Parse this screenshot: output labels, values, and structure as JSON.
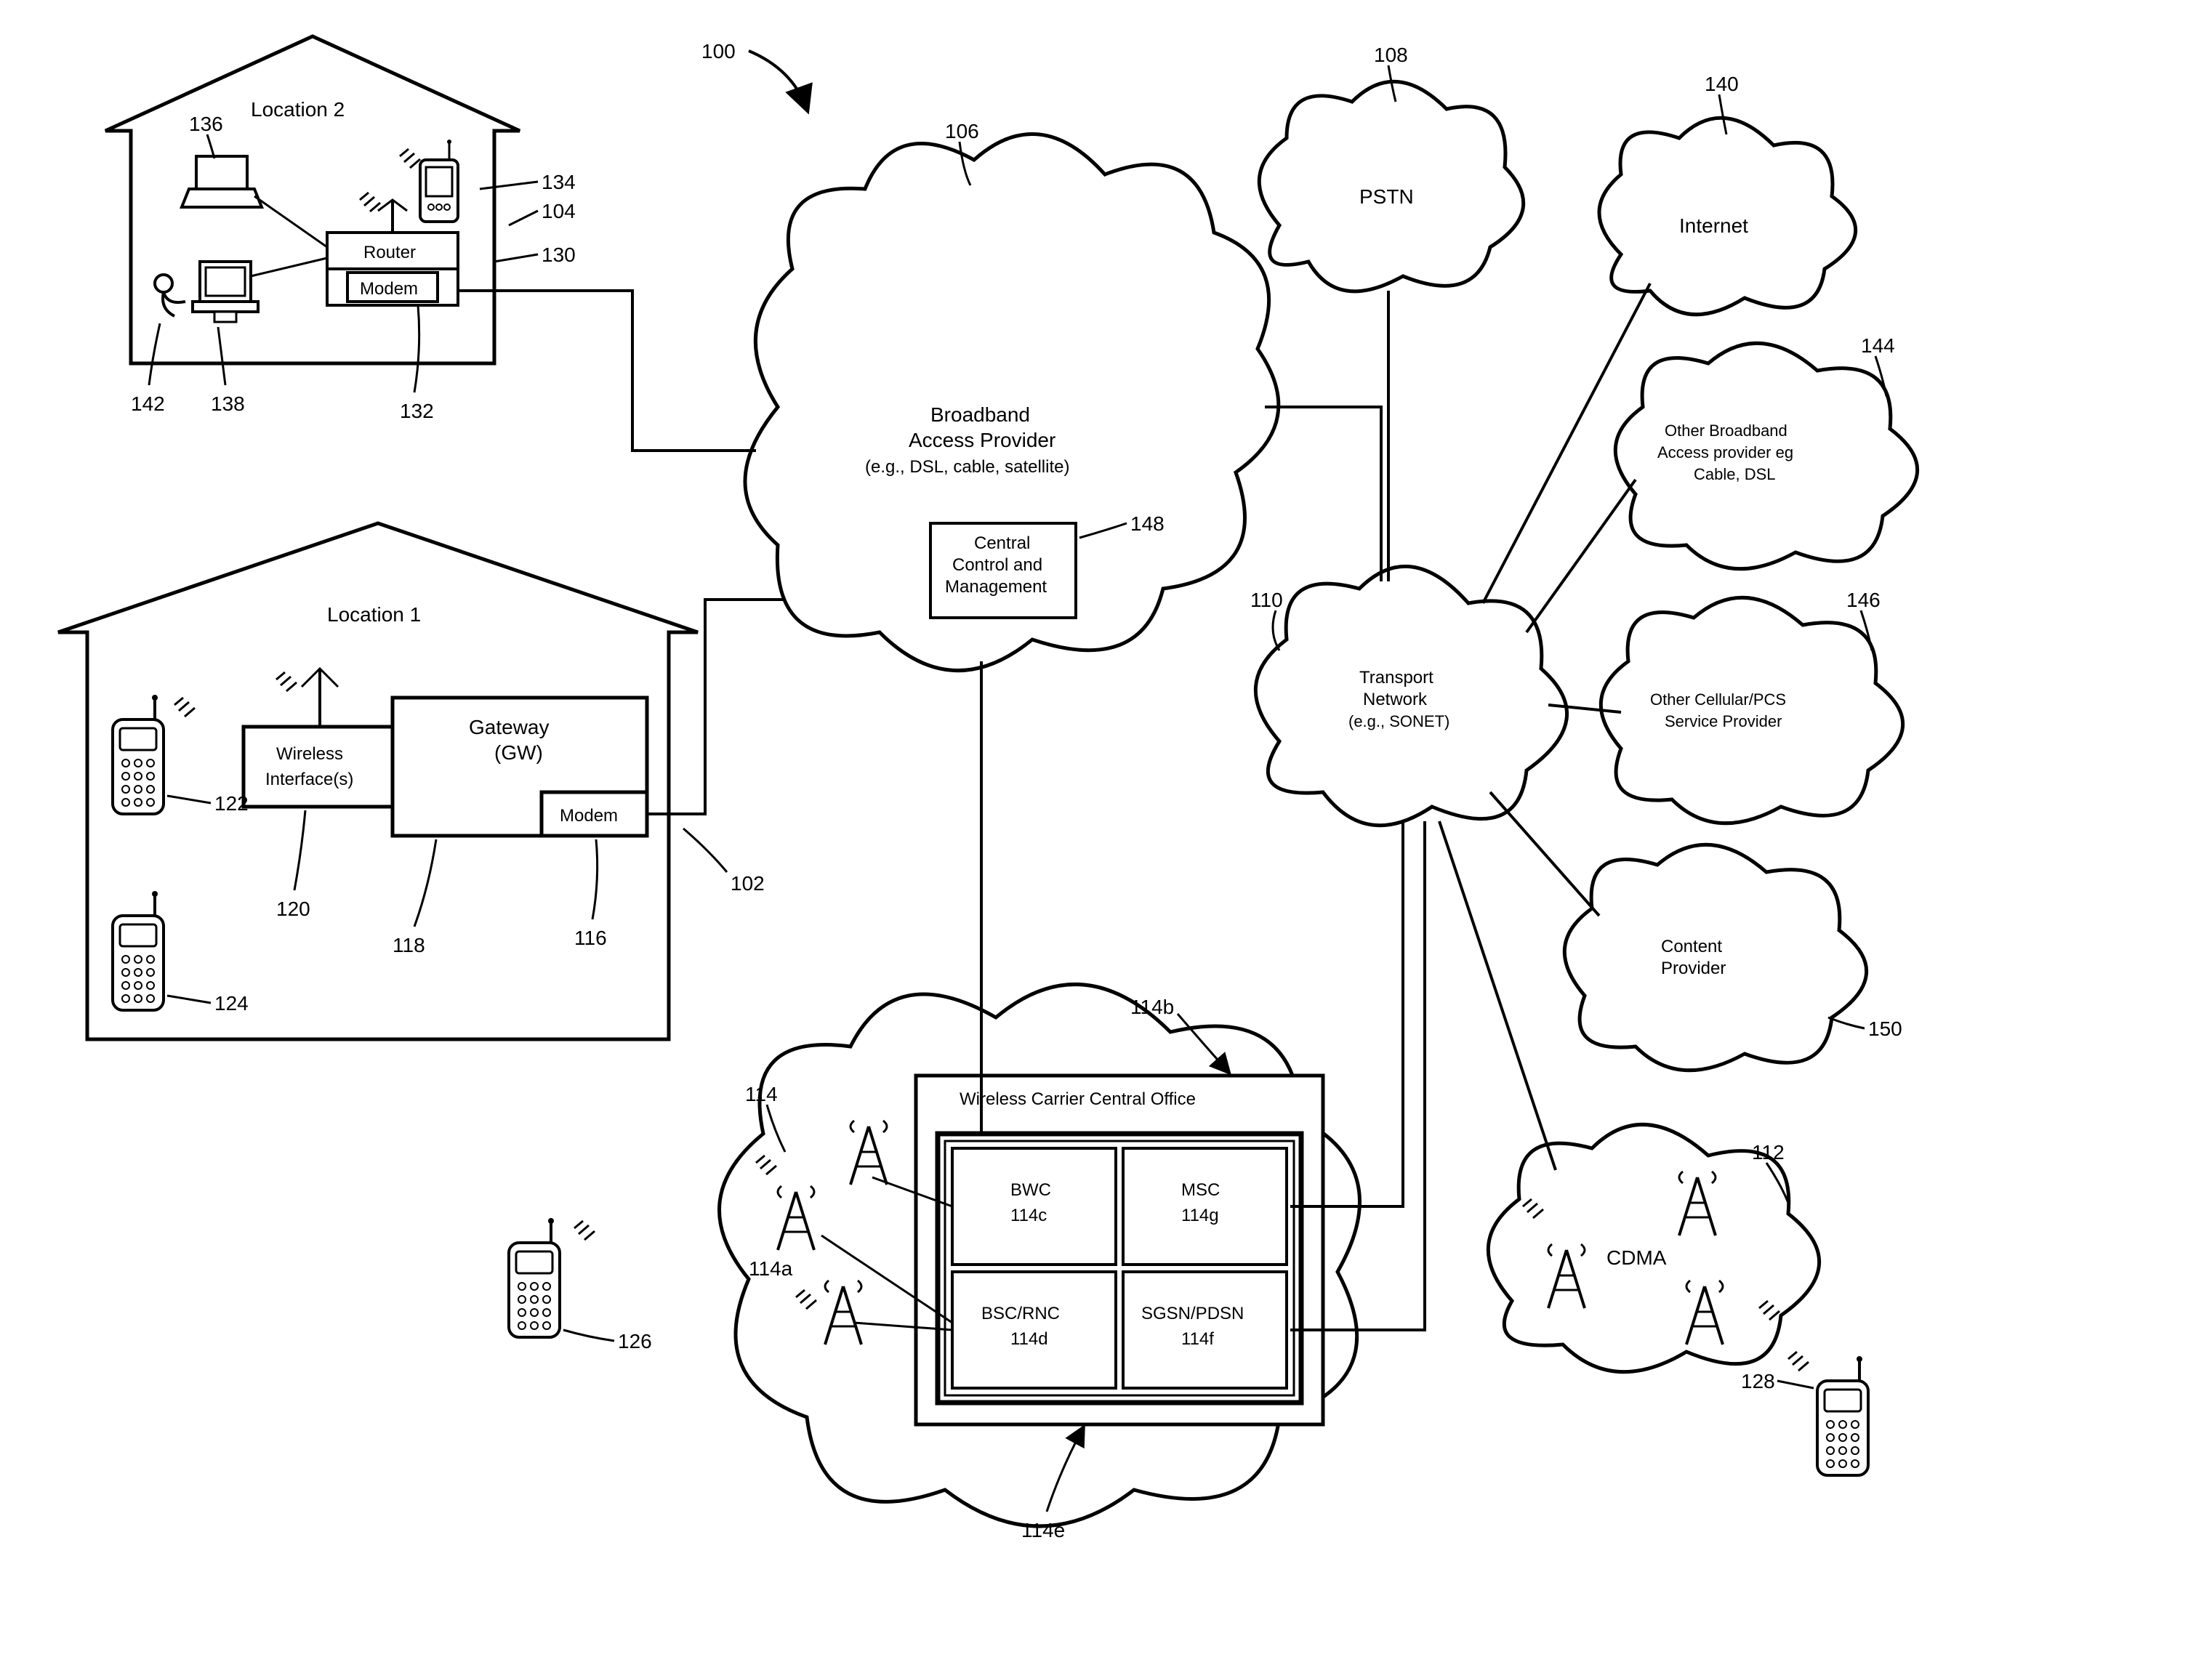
{
  "figure_ref": "100",
  "locations": {
    "loc2": {
      "title": "Location 2",
      "router": "Router",
      "modem": "Modem",
      "refs": {
        "loc": "104",
        "router": "130",
        "modem": "132",
        "pda": "134",
        "laptop": "136",
        "pc": "138",
        "user": "142"
      }
    },
    "loc1": {
      "title": "Location 1",
      "gateway_line1": "Gateway",
      "gateway_line2": "(GW)",
      "wireless_if_line1": "Wireless",
      "wireless_if_line2": "Interface(s)",
      "modem": "Modem",
      "refs": {
        "loc": "102",
        "modem": "116",
        "gateway": "118",
        "wi": "120",
        "phone_upper": "122",
        "phone_lower": "124"
      }
    }
  },
  "clouds": {
    "bap": {
      "line1": "Broadband",
      "line2": "Access Provider",
      "line3": "(e.g., DSL, cable, satellite)",
      "ccm_line1": "Central",
      "ccm_line2": "Control and",
      "ccm_line3": "Management",
      "refs": {
        "cloud": "106",
        "ccm": "148"
      }
    },
    "pstn": {
      "label": "PSTN",
      "ref": "108"
    },
    "internet": {
      "label": "Internet",
      "ref": "140"
    },
    "other_bb": {
      "line1": "Other Broadband",
      "line2": "Access provider eg",
      "line3": "Cable, DSL",
      "ref": "144"
    },
    "transport": {
      "line1": "Transport",
      "line2": "Network",
      "line3": "(e.g., SONET)",
      "ref": "110"
    },
    "other_cell": {
      "line1": "Other Cellular/PCS",
      "line2": "Service Provider",
      "ref": "146"
    },
    "content": {
      "line1": "Content",
      "line2": "Provider",
      "ref": "150"
    },
    "cdma": {
      "label": "CDMA",
      "ref": "112"
    },
    "wcco": {
      "title": "Wireless Carrier Central Office",
      "bwc_line1": "BWC",
      "bwc_line2": "114c",
      "msc_line1": "MSC",
      "msc_line2": "114g",
      "bsc_line1": "BSC/RNC",
      "bsc_line2": "114d",
      "sgsn_line1": "SGSN/PDSN",
      "sgsn_line2": "114f",
      "refs": {
        "cloud": "114",
        "towers": "114a",
        "office": "114b",
        "switch": "114e"
      }
    }
  },
  "roaming_phones": {
    "outside_loc1": "126",
    "outside_cdma": "128"
  }
}
